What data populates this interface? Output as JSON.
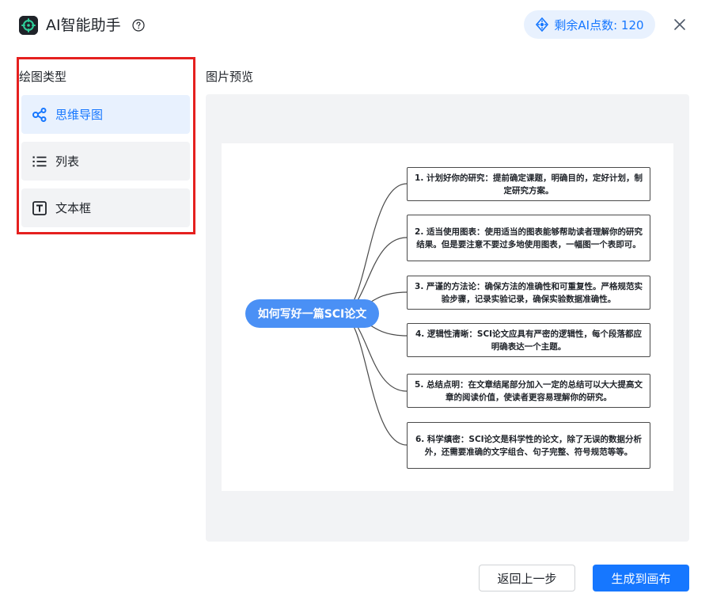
{
  "header": {
    "title": "AI智能助手",
    "credits_label": "剩余AI点数: 120"
  },
  "sidebar": {
    "section_label": "绘图类型",
    "items": [
      {
        "label": "思维导图",
        "icon": "mindmap-icon",
        "active": true
      },
      {
        "label": "列表",
        "icon": "list-icon",
        "active": false
      },
      {
        "label": "文本框",
        "icon": "textbox-icon",
        "active": false
      }
    ]
  },
  "preview": {
    "section_label": "图片预览",
    "mindmap": {
      "root": "如何写好一篇SCI论文",
      "nodes": [
        "1. 计划好你的研究：提前确定课题，明确目的，定好计划，制定研究方案。",
        "2. 适当使用图表：使用适当的图表能够帮助读者理解你的研究结果。但是要注意不要过多地使用图表，一幅图一个表即可。",
        "3. 严谨的方法论：确保方法的准确性和可重复性。严格规范实验步骤，记录实验记录，确保实验数据准确性。",
        "4. 逻辑性清晰：SCI论文应具有严密的逻辑性，每个段落都应明确表达一个主题。",
        "5. 总结点明：在文章结尾部分加入一定的总结可以大大提高文章的阅读价值，使读者更容易理解你的研究。",
        "6. 科学缜密：SCI论文是科学性的论文，除了无误的数据分析外，还需要准确的文字组合、句子完整、符号规范等等。"
      ]
    }
  },
  "footer": {
    "back_label": "返回上一步",
    "generate_label": "生成到画布"
  },
  "colors": {
    "accent": "#1677ff",
    "highlight_border": "#e5201f",
    "mindmap_root": "#4a90f5"
  }
}
